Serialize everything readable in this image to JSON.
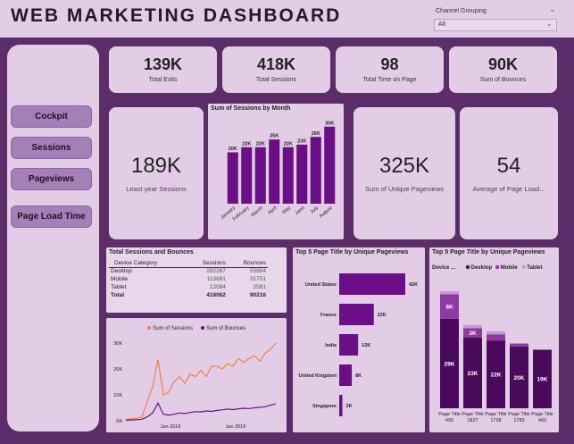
{
  "header": {
    "title": "WEB  MARKETING  DASHBOARD",
    "filter_label": "Channel Grouping",
    "filter_value": "All"
  },
  "nav": {
    "cockpit": "Cockpit",
    "sessions": "Sessions",
    "pageviews": "Pageviews",
    "page_load_time": "Page Load Time"
  },
  "kpis": {
    "total_exits": {
      "value": "139K",
      "label": "Total Exits"
    },
    "total_sessions": {
      "value": "418K",
      "label": "Total Sessions"
    },
    "total_time": {
      "value": "98",
      "label": "Total Time on Page"
    },
    "sum_bounces": {
      "value": "90K",
      "label": "Sum of Bounces"
    },
    "least_year": {
      "value": "189K",
      "label": "Least year Sessions"
    },
    "unique_pageviews": {
      "value": "325K",
      "label": "Sum of Unique Pageviews"
    },
    "avg_page_load": {
      "value": "54",
      "label": "Average of Page Load..."
    }
  },
  "table": {
    "title": "Total Sessions and Bounces",
    "headers": [
      "Device Category",
      "Sessions",
      "Bounces"
    ],
    "rows": [
      [
        "Desktop",
        "292287",
        "55884"
      ],
      [
        "Mobile",
        "113691",
        "31751"
      ],
      [
        "Tablet",
        "12084",
        "2581"
      ]
    ],
    "total": [
      "Total",
      "418062",
      "90216"
    ]
  },
  "colors": {
    "accent_purple": "#6a0f86",
    "dark_purple": "#4a0a5c",
    "mid_purple": "#8e3aa0",
    "light_purple": "#c59bd0",
    "orange": "#f08040"
  },
  "chart_data": [
    {
      "type": "bar",
      "title": "Sum of Sessions by Month",
      "categories": [
        "January",
        "February",
        "March",
        "April",
        "May",
        "June",
        "July",
        "August"
      ],
      "values": [
        20,
        22,
        22,
        25,
        22,
        23,
        26,
        30
      ],
      "value_labels": [
        "20K",
        "22K",
        "22K",
        "25K",
        "22K",
        "23K",
        "26K",
        "30K"
      ],
      "ylim": [
        0,
        32
      ]
    },
    {
      "type": "bar",
      "orientation": "horizontal",
      "title": "Top 5 Page Title by Unique Pageviews",
      "categories": [
        "United States",
        "France",
        "India",
        "United Kingdom",
        "Singapore"
      ],
      "values": [
        42,
        22,
        12,
        8,
        2
      ],
      "value_labels": [
        "42K",
        "22K",
        "12K",
        "8K",
        "2K"
      ],
      "xlim": [
        0,
        42
      ]
    },
    {
      "type": "bar",
      "stacked": true,
      "title": "Top 5 Page Title by Unique Pageviews",
      "legend_title": "Device ...",
      "categories": [
        "Page Title 496",
        "Page Title 1827",
        "Page Title 1798",
        "Page Title 1783",
        "Page Title 460"
      ],
      "series": [
        {
          "name": "Desktop",
          "values": [
            29,
            23,
            22,
            20,
            19
          ],
          "labels": [
            "29K",
            "23K",
            "22K",
            "20K",
            "19K"
          ]
        },
        {
          "name": "Mobile",
          "values": [
            8,
            3,
            2,
            1,
            0
          ],
          "labels": [
            "8K",
            "3K",
            "",
            "",
            ""
          ]
        },
        {
          "name": "Tablet",
          "values": [
            1,
            1,
            1,
            0,
            0
          ],
          "labels": [
            "",
            "",
            "",
            "",
            ""
          ]
        }
      ],
      "ylim": [
        0,
        40
      ]
    },
    {
      "type": "line",
      "series": [
        {
          "name": "Sum of Sessions",
          "values": [
            0.5,
            0.8,
            1.0,
            1.5,
            7.5,
            13,
            23.5,
            10,
            11,
            15,
            17,
            14.5,
            18,
            17,
            19.5,
            17,
            21,
            21,
            20,
            22,
            21,
            24,
            22.5,
            24,
            25,
            23,
            26,
            27.5,
            30
          ]
        },
        {
          "name": "Sum of Bounces",
          "values": [
            0.2,
            0.3,
            0.4,
            0.6,
            1.5,
            3,
            6.8,
            2.5,
            2.2,
            2.5,
            3,
            2.8,
            3.2,
            3.5,
            3.4,
            3.8,
            3.6,
            4,
            4.2,
            4.5,
            4.3,
            4.6,
            4.8,
            4.7,
            5,
            5.2,
            5.4,
            6,
            6.5
          ]
        }
      ],
      "x_tick_labels": [
        "Jan 2018",
        "Jan 2019"
      ],
      "y_tick_labels": [
        "0K",
        "10K",
        "20K",
        "30K"
      ],
      "ylim": [
        0,
        32
      ],
      "legend_position": "top"
    }
  ]
}
